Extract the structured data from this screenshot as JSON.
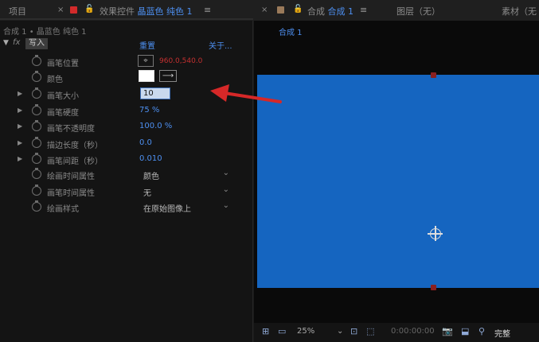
{
  "tabs": {
    "project": "项目",
    "effects_prefix": "效果控件",
    "effects_active": "晶蓝色 纯色 1",
    "comp_prefix": "合成",
    "comp_active": "合成 1",
    "layer": "图层（无）",
    "footage": "素材（无"
  },
  "effects": {
    "path": "合成 1 • 晶蓝色 纯色 1",
    "effect_name": "写入",
    "reset_label": "重置",
    "about_label": "关于...",
    "props": [
      {
        "label": "画笔位置",
        "value": "960.0,540.0"
      },
      {
        "label": "颜色"
      },
      {
        "label": "画笔大小",
        "value": "10"
      },
      {
        "label": "画笔硬度",
        "value": "75 %"
      },
      {
        "label": "画笔不透明度",
        "value": "100.0 %"
      },
      {
        "label": "描边长度（秒）",
        "value": "0.0"
      },
      {
        "label": "画笔间距（秒）",
        "value": "0.010"
      },
      {
        "label": "绘画时间属性",
        "value": "颜色"
      },
      {
        "label": "画笔时间属性",
        "value": "无"
      },
      {
        "label": "绘画样式",
        "value": "在原始图像上"
      }
    ]
  },
  "comp": {
    "sub_tab": "合成 1",
    "zoom": "25%",
    "timecode": "0:00:00:00",
    "quality": "完整"
  },
  "colors": {
    "accent": "#4d8ff0",
    "canvas": "#1565c0",
    "annotation": "#d62828"
  },
  "icons": [
    "close-icon",
    "lock-icon",
    "menu-icon",
    "stopwatch-icon",
    "crosshair-icon",
    "eyedropper-icon",
    "anchor-point-icon",
    "monitor-icon",
    "camera-icon",
    "region-icon"
  ]
}
